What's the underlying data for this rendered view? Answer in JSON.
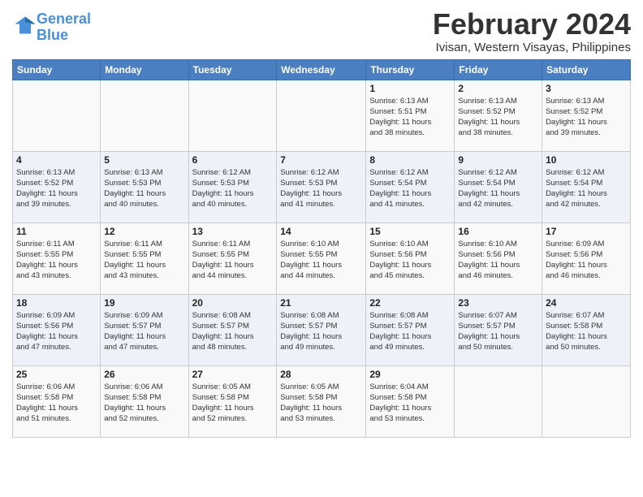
{
  "logo": {
    "line1": "General",
    "line2": "Blue"
  },
  "title": "February 2024",
  "location": "Ivisan, Western Visayas, Philippines",
  "days_of_week": [
    "Sunday",
    "Monday",
    "Tuesday",
    "Wednesday",
    "Thursday",
    "Friday",
    "Saturday"
  ],
  "weeks": [
    [
      {
        "day": "",
        "info": ""
      },
      {
        "day": "",
        "info": ""
      },
      {
        "day": "",
        "info": ""
      },
      {
        "day": "",
        "info": ""
      },
      {
        "day": "1",
        "info": "Sunrise: 6:13 AM\nSunset: 5:51 PM\nDaylight: 11 hours\nand 38 minutes."
      },
      {
        "day": "2",
        "info": "Sunrise: 6:13 AM\nSunset: 5:52 PM\nDaylight: 11 hours\nand 38 minutes."
      },
      {
        "day": "3",
        "info": "Sunrise: 6:13 AM\nSunset: 5:52 PM\nDaylight: 11 hours\nand 39 minutes."
      }
    ],
    [
      {
        "day": "4",
        "info": "Sunrise: 6:13 AM\nSunset: 5:52 PM\nDaylight: 11 hours\nand 39 minutes."
      },
      {
        "day": "5",
        "info": "Sunrise: 6:13 AM\nSunset: 5:53 PM\nDaylight: 11 hours\nand 40 minutes."
      },
      {
        "day": "6",
        "info": "Sunrise: 6:12 AM\nSunset: 5:53 PM\nDaylight: 11 hours\nand 40 minutes."
      },
      {
        "day": "7",
        "info": "Sunrise: 6:12 AM\nSunset: 5:53 PM\nDaylight: 11 hours\nand 41 minutes."
      },
      {
        "day": "8",
        "info": "Sunrise: 6:12 AM\nSunset: 5:54 PM\nDaylight: 11 hours\nand 41 minutes."
      },
      {
        "day": "9",
        "info": "Sunrise: 6:12 AM\nSunset: 5:54 PM\nDaylight: 11 hours\nand 42 minutes."
      },
      {
        "day": "10",
        "info": "Sunrise: 6:12 AM\nSunset: 5:54 PM\nDaylight: 11 hours\nand 42 minutes."
      }
    ],
    [
      {
        "day": "11",
        "info": "Sunrise: 6:11 AM\nSunset: 5:55 PM\nDaylight: 11 hours\nand 43 minutes."
      },
      {
        "day": "12",
        "info": "Sunrise: 6:11 AM\nSunset: 5:55 PM\nDaylight: 11 hours\nand 43 minutes."
      },
      {
        "day": "13",
        "info": "Sunrise: 6:11 AM\nSunset: 5:55 PM\nDaylight: 11 hours\nand 44 minutes."
      },
      {
        "day": "14",
        "info": "Sunrise: 6:10 AM\nSunset: 5:55 PM\nDaylight: 11 hours\nand 44 minutes."
      },
      {
        "day": "15",
        "info": "Sunrise: 6:10 AM\nSunset: 5:56 PM\nDaylight: 11 hours\nand 45 minutes."
      },
      {
        "day": "16",
        "info": "Sunrise: 6:10 AM\nSunset: 5:56 PM\nDaylight: 11 hours\nand 46 minutes."
      },
      {
        "day": "17",
        "info": "Sunrise: 6:09 AM\nSunset: 5:56 PM\nDaylight: 11 hours\nand 46 minutes."
      }
    ],
    [
      {
        "day": "18",
        "info": "Sunrise: 6:09 AM\nSunset: 5:56 PM\nDaylight: 11 hours\nand 47 minutes."
      },
      {
        "day": "19",
        "info": "Sunrise: 6:09 AM\nSunset: 5:57 PM\nDaylight: 11 hours\nand 47 minutes."
      },
      {
        "day": "20",
        "info": "Sunrise: 6:08 AM\nSunset: 5:57 PM\nDaylight: 11 hours\nand 48 minutes."
      },
      {
        "day": "21",
        "info": "Sunrise: 6:08 AM\nSunset: 5:57 PM\nDaylight: 11 hours\nand 49 minutes."
      },
      {
        "day": "22",
        "info": "Sunrise: 6:08 AM\nSunset: 5:57 PM\nDaylight: 11 hours\nand 49 minutes."
      },
      {
        "day": "23",
        "info": "Sunrise: 6:07 AM\nSunset: 5:57 PM\nDaylight: 11 hours\nand 50 minutes."
      },
      {
        "day": "24",
        "info": "Sunrise: 6:07 AM\nSunset: 5:58 PM\nDaylight: 11 hours\nand 50 minutes."
      }
    ],
    [
      {
        "day": "25",
        "info": "Sunrise: 6:06 AM\nSunset: 5:58 PM\nDaylight: 11 hours\nand 51 minutes."
      },
      {
        "day": "26",
        "info": "Sunrise: 6:06 AM\nSunset: 5:58 PM\nDaylight: 11 hours\nand 52 minutes."
      },
      {
        "day": "27",
        "info": "Sunrise: 6:05 AM\nSunset: 5:58 PM\nDaylight: 11 hours\nand 52 minutes."
      },
      {
        "day": "28",
        "info": "Sunrise: 6:05 AM\nSunset: 5:58 PM\nDaylight: 11 hours\nand 53 minutes."
      },
      {
        "day": "29",
        "info": "Sunrise: 6:04 AM\nSunset: 5:58 PM\nDaylight: 11 hours\nand 53 minutes."
      },
      {
        "day": "",
        "info": ""
      },
      {
        "day": "",
        "info": ""
      }
    ]
  ]
}
